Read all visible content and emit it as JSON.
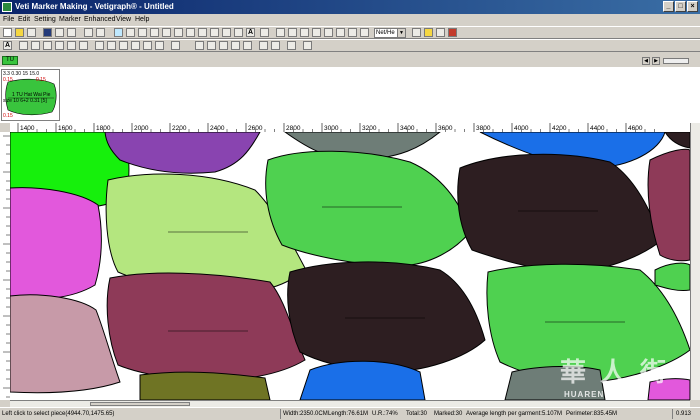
{
  "window": {
    "title": "Veti Marker Making - Vetigraph® - Untitled"
  },
  "menu": [
    "File",
    "Edit",
    "Setting",
    "Marker",
    "Enhanced",
    "View",
    "Help"
  ],
  "toolbar": {
    "mode_combo": "Net/He"
  },
  "layer": {
    "tab_label": "TU"
  },
  "thumbnail": {
    "header": "3.3 0.30 15 15.0",
    "top_red_left": "0.15",
    "top_red_right": "0.15",
    "center_line1": "1 TU Hat Wai Pie",
    "center_line2": "size 10 6+2 0.31 [5]",
    "bottom_red": "0.15"
  },
  "ruler_h": [
    "1400",
    "1600",
    "1800",
    "2000",
    "2200",
    "2400",
    "2600",
    "2800",
    "3000",
    "3200",
    "3400",
    "3600",
    "3800",
    "4000",
    "4200",
    "4400",
    "4600"
  ],
  "status": {
    "hint": "Left click to select piece(4944.70,1475.65)",
    "width": "Width:2350.0CM",
    "length": "Length:76.61M",
    "ur": "U.R.:74%",
    "total": "Total:30",
    "marked": "Marked:30",
    "avg": "Average length per garment:5.107M",
    "perimeter": "Perimeter:835.45M",
    "zoom": "0.913"
  },
  "watermark": {
    "chars": [
      "華",
      "人",
      "街"
    ],
    "site": "HUAREN"
  },
  "colors": {
    "title_bar": "#0a246a",
    "light_green": "#b4e67f",
    "green": "#4fd150",
    "dark_brown": "#2d1e21",
    "maroon": "#8e3a58",
    "magenta": "#e258dc",
    "purple": "#8944b0",
    "blue": "#1a6fe8",
    "mauve": "#c79aa8",
    "olive": "#6f7424",
    "slate": "#6e7d77"
  }
}
